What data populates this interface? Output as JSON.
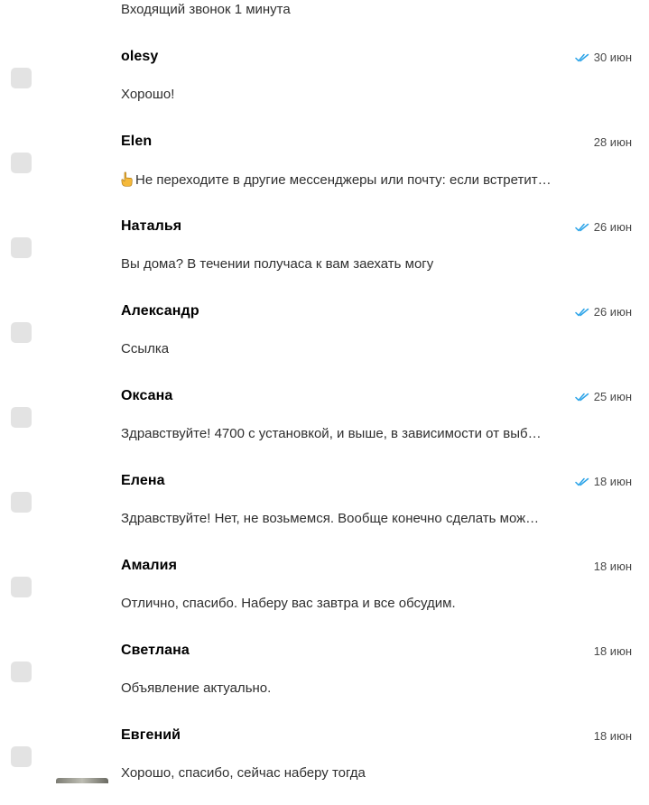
{
  "top_preview": "Входящий звонок 1 минута",
  "colors": {
    "read_check": "#2aa3e8",
    "checkbox": "#e3e3e3",
    "text": "#000000",
    "muted": "#4a4a4a"
  },
  "icons": {
    "read": "double-check-icon",
    "finger": "pointing-finger-icon"
  },
  "chats": [
    {
      "name": "olesy",
      "date": "30 июн",
      "read": true,
      "preview": "Хорошо!"
    },
    {
      "name": "Elen",
      "date": "28 июн",
      "read": false,
      "preview": "Не переходите в другие мессенджеры или почту: если встретит…",
      "has_finger": true
    },
    {
      "name": "Наталья",
      "date": "26 июн",
      "read": true,
      "preview": "Вы дома? В течении получаса к вам заехать могу"
    },
    {
      "name": "Александр",
      "date": "26 июн",
      "read": true,
      "preview": "Ссылка"
    },
    {
      "name": "Оксана",
      "date": "25 июн",
      "read": true,
      "preview": "Здравствуйте! 4700 с установкой, и выше, в зависимости от выб…"
    },
    {
      "name": "Елена",
      "date": "18 июн",
      "read": true,
      "preview": "Здравствуйте! Нет, не возьмемся. Вообще конечно сделать мож…"
    },
    {
      "name": "Амалия",
      "date": "18 июн",
      "read": false,
      "preview": "Отлично, спасибо. Наберу вас завтра и все обсудим."
    },
    {
      "name": "Светлана",
      "date": "18 июн",
      "read": false,
      "preview": "Объявление актуально."
    },
    {
      "name": "Евгений",
      "date": "18 июн",
      "read": false,
      "preview": "Хорошо, спасибо, сейчас наберу тогда"
    }
  ]
}
